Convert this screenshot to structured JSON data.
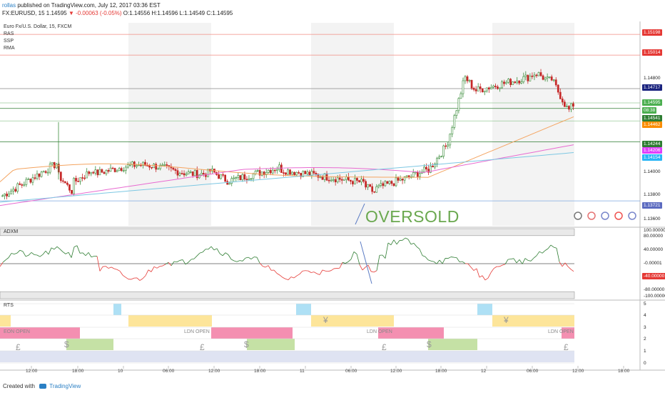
{
  "header": {
    "author": "rollas",
    "published": " published on TradingView.com, July 12, 2017 03:36 EST",
    "symbol_line_prefix": "FX:EURUSD, 15  1.14595 ",
    "change_text": "▼ -0.00063 (-0.05%)",
    "ohlc": " O:1.14556 H:1.14596 L:1.14549 C:1.14595"
  },
  "pane_labels": {
    "title": "Euro Fx/U.S. Dollar, 15, FXCM",
    "indicators": [
      "RAS",
      "SSP",
      "RMA"
    ],
    "adx": "ADXM",
    "rts": "RTS"
  },
  "annotation": {
    "text": "OVERSOLD"
  },
  "price_tags": [
    {
      "text": "1.15198",
      "color": "#e53935"
    },
    {
      "text": "1.15014",
      "color": "#e53935"
    },
    {
      "text": "1.14800",
      "color": ""
    },
    {
      "text": "1.14717",
      "color": "#1a237e"
    },
    {
      "text": "1.14595",
      "color": "#4caf50"
    },
    {
      "text": "08:38",
      "color": "#4caf50"
    },
    {
      "text": "1.14541",
      "color": "#2e7d32"
    },
    {
      "text": "1.14462",
      "color": "#fb8c00"
    },
    {
      "text": "1.14244",
      "color": "#2e7d32"
    },
    {
      "text": "1.14206",
      "color": "#e040fb"
    },
    {
      "text": "1.14154",
      "color": "#29b6f6"
    },
    {
      "text": "1.14000",
      "color": ""
    },
    {
      "text": "1.13800",
      "color": ""
    },
    {
      "text": "1.13721",
      "color": "#5c6bc0"
    },
    {
      "text": "1.13600",
      "color": ""
    }
  ],
  "adx_tags": [
    {
      "text": "100.00000",
      "color": ""
    },
    {
      "text": "80.00000",
      "color": ""
    },
    {
      "text": "40.00000",
      "color": ""
    },
    {
      "text": "-0.00001",
      "color": ""
    },
    {
      "text": "-40.00000",
      "color": "#e53935"
    },
    {
      "text": "-80.00000",
      "color": ""
    },
    {
      "text": "-100.00000",
      "color": ""
    }
  ],
  "rts_levels": [
    "5",
    "4",
    "3",
    "2",
    "1",
    "0"
  ],
  "rts_tags": [
    "EON OPEN",
    "LDN OPEN",
    "LDN OPEN",
    "LDN OPEN"
  ],
  "time_labels": [
    "12:00",
    "18:00",
    "10",
    "06:00",
    "12:00",
    "18:00",
    "11",
    "06:00",
    "12:00",
    "18:00",
    "12",
    "06:00",
    "12:00",
    "18:00"
  ],
  "footer": {
    "created": "Created with",
    "brand": "TradingView"
  },
  "colors": {
    "up": "#26a69a",
    "down": "#ef5350",
    "bar_up": "#2e7d32",
    "ma_orange": "#f4a460",
    "ma_magenta": "#e86bd1",
    "ma_blue": "#7ec8e3",
    "annotation": "#6aa84f"
  },
  "chart_data": {
    "type": "line",
    "title": "Euro Fx/U.S. Dollar, 15, FXCM",
    "xlabel": "",
    "ylabel": "",
    "x": [
      "12:00",
      "18:00",
      "10",
      "06:00",
      "12:00",
      "18:00",
      "11",
      "06:00",
      "12:00",
      "18:00",
      "12",
      "06:00",
      "12:00",
      "18:00"
    ],
    "ylim": [
      1.135,
      1.153
    ],
    "series": [
      {
        "name": "",
        "values": [
          1.1378,
          1.1402,
          1.1398,
          1.1407,
          1.141,
          1.14,
          1.1398,
          1.1388,
          1.139,
          1.1425,
          1.147,
          1.1482,
          1.1459
        ]
      }
    ],
    "levels": [
      1.15198,
      1.15014,
      1.14717,
      1.14541,
      1.14244,
      1.13721
    ],
    "grid": true
  }
}
